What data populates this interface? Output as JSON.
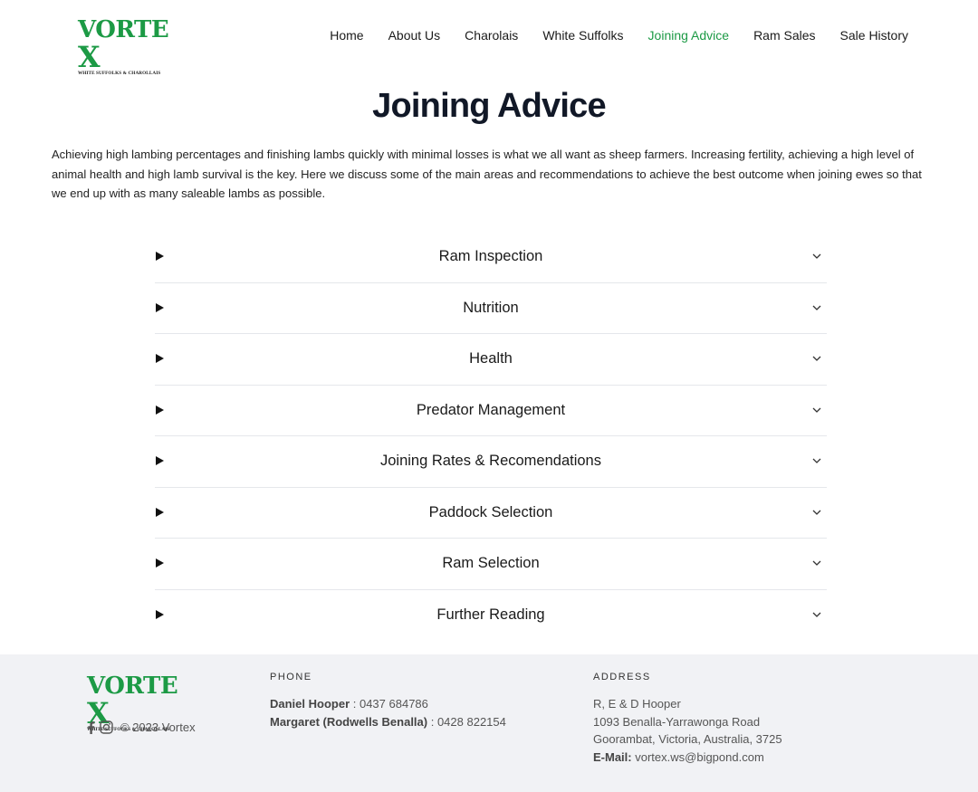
{
  "brand": {
    "logo_word_main": "VORTE",
    "logo_word_x": "X",
    "logo_tagline": "WHITE SUFFOLKS & CHAROLLAIS",
    "color": "#1c9a45"
  },
  "nav": {
    "items": [
      {
        "label": "Home"
      },
      {
        "label": "About Us"
      },
      {
        "label": "Charolais"
      },
      {
        "label": "White Suffolks"
      },
      {
        "label": "Joining Advice",
        "active": true
      },
      {
        "label": "Ram Sales"
      },
      {
        "label": "Sale History"
      }
    ]
  },
  "page": {
    "title": "Joining Advice",
    "intro": "Achieving high lambing percentages and finishing lambs quickly with minimal losses is what we all want as sheep farmers. Increasing fertility, achieving a high level of animal health and high lamb survival is the key. Here we discuss some of the main areas and recommendations to achieve the best outcome when joining ewes so that we end up with as many saleable lambs as possible."
  },
  "accordion": {
    "items": [
      {
        "label": "Ram Inspection"
      },
      {
        "label": "Nutrition"
      },
      {
        "label": "Health"
      },
      {
        "label": "Predator Management"
      },
      {
        "label": "Joining Rates & Recomendations"
      },
      {
        "label": "Paddock Selection"
      },
      {
        "label": "Ram Selection"
      },
      {
        "label": "Further Reading"
      }
    ]
  },
  "footer": {
    "copyright": "© 2023 Vortex",
    "social_icons": [
      "facebook-icon",
      "instagram-icon"
    ],
    "phone": {
      "heading": "PHONE",
      "contacts": [
        {
          "name": "Daniel Hooper",
          "sep": " : ",
          "number": "0437 684786"
        },
        {
          "name": "Margaret (Rodwells Benalla)",
          "sep": " : ",
          "number": "0428 822154"
        }
      ]
    },
    "address": {
      "heading": "ADDRESS",
      "lines": [
        "R, E & D Hooper",
        "1093 Benalla-Yarrawonga Road",
        "Goorambat, Victoria, Australia, 3725"
      ],
      "email_label": "E-Mail:",
      "email": " vortex.ws@bigpond.com"
    }
  }
}
